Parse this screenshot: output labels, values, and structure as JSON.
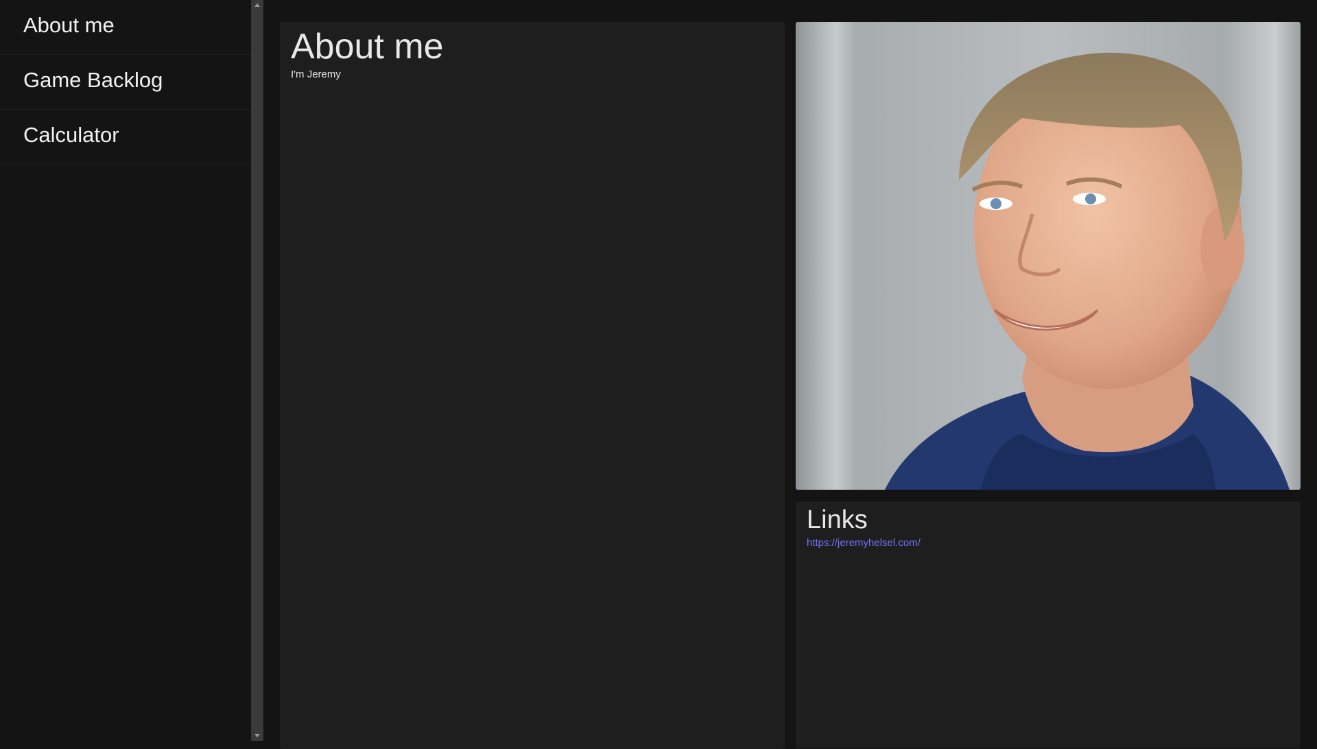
{
  "sidebar": {
    "items": [
      {
        "label": "About me"
      },
      {
        "label": "Game Backlog"
      },
      {
        "label": "Calculator"
      }
    ]
  },
  "about": {
    "title": "About me",
    "subtitle": "I'm Jeremy"
  },
  "photo": {
    "alt": "Portrait of Jeremy"
  },
  "links": {
    "title": "Links",
    "items": [
      {
        "label": "https://jeremyhelsel.com/"
      }
    ]
  },
  "colors": {
    "background": "#141414",
    "panel": "#1e1e1e",
    "link": "#6f74f5",
    "scrollbar": "#3a3a3a"
  }
}
